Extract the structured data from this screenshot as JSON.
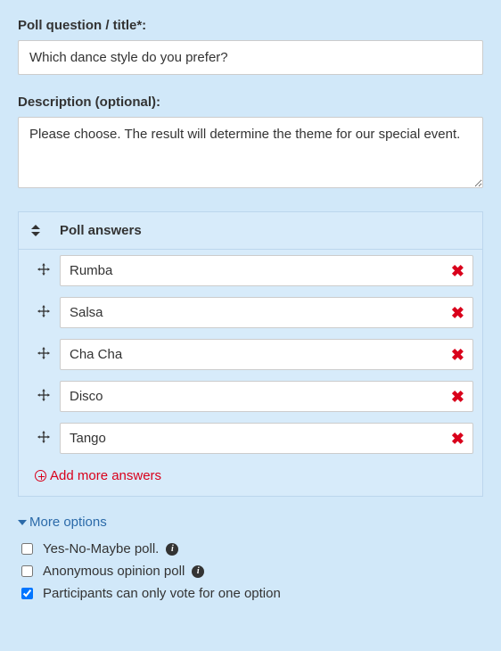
{
  "poll": {
    "question_label": "Poll question / title*:",
    "question_value": "Which dance style do you prefer?",
    "description_label": "Description (optional):",
    "description_value": "Please choose. The result will determine the theme for our special event."
  },
  "answers": {
    "header": "Poll answers",
    "items": [
      {
        "value": "Rumba"
      },
      {
        "value": "Salsa"
      },
      {
        "value": "Cha Cha"
      },
      {
        "value": "Disco"
      },
      {
        "value": "Tango"
      }
    ],
    "add_more": "Add more answers"
  },
  "options": {
    "toggle_label": "More options",
    "items": [
      {
        "label": "Yes-No-Maybe poll.",
        "checked": false,
        "info": true
      },
      {
        "label": "Anonymous opinion poll",
        "checked": false,
        "info": true
      },
      {
        "label": "Participants can only vote for one option",
        "checked": true,
        "info": false
      }
    ]
  }
}
